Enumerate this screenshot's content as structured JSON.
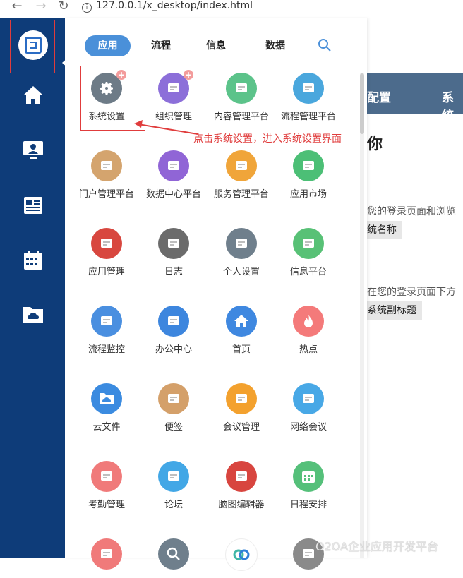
{
  "browser": {
    "url": "127.0.0.1/x_desktop/index.html"
  },
  "menu": {
    "tabs": [
      "应用",
      "流程",
      "信息",
      "数据"
    ],
    "apps": [
      {
        "label": "系统设置",
        "color": "#6d7b87",
        "icon": "gear-icon",
        "badge": "+"
      },
      {
        "label": "组织管理",
        "color": "#8c6fd9",
        "icon": "org-icon",
        "badge": "+"
      },
      {
        "label": "内容管理平台",
        "color": "#5cc38a",
        "icon": "content-icon",
        "badge": ""
      },
      {
        "label": "流程管理平台",
        "color": "#4aa7dd",
        "icon": "process-icon",
        "badge": ""
      },
      {
        "label": "门户管理平台",
        "color": "#d4a46e",
        "icon": "portal-icon",
        "badge": ""
      },
      {
        "label": "数据中心平台",
        "color": "#9065d6",
        "icon": "data-center-icon",
        "badge": ""
      },
      {
        "label": "服务管理平台",
        "color": "#f0a53a",
        "icon": "service-icon",
        "badge": ""
      },
      {
        "label": "应用市场",
        "color": "#4cbf76",
        "icon": "market-bag-icon",
        "badge": ""
      },
      {
        "label": "应用管理",
        "color": "#d8473f",
        "icon": "app-manage-icon",
        "badge": ""
      },
      {
        "label": "日志",
        "color": "#6b6b6b",
        "icon": "log-icon",
        "badge": ""
      },
      {
        "label": "个人设置",
        "color": "#6f7f8c",
        "icon": "user-settings-icon",
        "badge": ""
      },
      {
        "label": "信息平台",
        "color": "#58c176",
        "icon": "info-platform-icon",
        "badge": ""
      },
      {
        "label": "流程监控",
        "color": "#4a8fe0",
        "icon": "gauge-icon",
        "badge": ""
      },
      {
        "label": "办公中心",
        "color": "#3d86de",
        "icon": "office-icon",
        "badge": ""
      },
      {
        "label": "首页",
        "color": "#3f88e0",
        "icon": "home-icon",
        "badge": ""
      },
      {
        "label": "热点",
        "color": "#f47a7a",
        "icon": "fire-icon",
        "badge": ""
      },
      {
        "label": "云文件",
        "color": "#3b8be0",
        "icon": "cloud-folder-icon",
        "badge": ""
      },
      {
        "label": "便签",
        "color": "#d4a06a",
        "icon": "note-icon",
        "badge": ""
      },
      {
        "label": "会议管理",
        "color": "#f3a12e",
        "icon": "meeting-icon",
        "badge": ""
      },
      {
        "label": "网络会议",
        "color": "#48a8e6",
        "icon": "web-meeting-icon",
        "badge": ""
      },
      {
        "label": "考勤管理",
        "color": "#f07a7a",
        "icon": "hand-icon",
        "badge": ""
      },
      {
        "label": "论坛",
        "color": "#42a7e6",
        "icon": "forum-icon",
        "badge": ""
      },
      {
        "label": "脑图编辑器",
        "color": "#d8453f",
        "icon": "mindmap-icon",
        "badge": ""
      },
      {
        "label": "日程安排",
        "color": "#55c07a",
        "icon": "calendar-icon",
        "badge": ""
      },
      {
        "label": "",
        "color": "#f07a7a",
        "icon": "brain-icon",
        "badge": ""
      },
      {
        "label": "",
        "color": "#6f7f8c",
        "icon": "search-icon",
        "badge": ""
      },
      {
        "label": "",
        "color": "#ffffff",
        "icon": "link-icon",
        "badge": ""
      },
      {
        "label": "",
        "color": "#8a8a8a",
        "icon": "calculator-icon",
        "badge": ""
      }
    ]
  },
  "annotation": "点击系统设置，进入系统设置界面",
  "background_page": {
    "header_items": [
      "配置",
      "系统"
    ],
    "heading": "你",
    "line1": "您的登录页面和浏览",
    "field1": "统名称",
    "line2": "在您的登录页面下方",
    "field2": "系统副标题"
  },
  "watermark": "O2OA企业应用开发平台"
}
